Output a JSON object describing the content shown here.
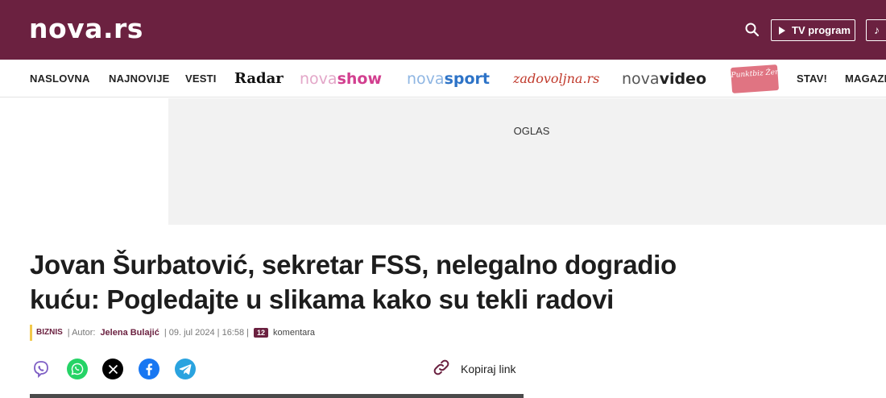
{
  "header": {
    "logo": "nova.rs",
    "tv_program_label": "TV program",
    "search_icon": "search-icon",
    "music_icon": "music-note-icon",
    "background_color": "#6b2140"
  },
  "nav": {
    "naslovna": "NASLOVNA",
    "najnovije": "NAJNOVIJE",
    "vesti": "VESTI",
    "radar": "Radar",
    "nova_show_a": "nova",
    "nova_show_b": "show",
    "nova_sport_a": "nova",
    "nova_sport_b": "sport",
    "zadovoljna": "zadovoljna.rs",
    "nova_video_a": "nova",
    "nova_video_b": "video",
    "badge_text": "Punktbiz Žena",
    "stav": "STAV!",
    "magazin": "MAGAZIN"
  },
  "ad": {
    "label": "OGLAS"
  },
  "article": {
    "headline": "Jovan Šurbatović, sekretar FSS, nelegalno dogradio kuću: Pogledajte u slikama kako su tekli radovi",
    "category": "BIZNIS",
    "author_prefix": "| Autor:",
    "author": "Jelena Bulajić",
    "date": "| 09. jul 2024 | 16:58 |",
    "comments_count": "12",
    "comments_label": "komentara"
  },
  "share": {
    "viber_icon": "viber-icon",
    "whatsapp_icon": "whatsapp-icon",
    "x_icon": "x-icon",
    "facebook_icon": "facebook-icon",
    "telegram_icon": "telegram-icon",
    "copy_link_label": "Kopiraj link",
    "colors": {
      "viber": "#7d5dc4",
      "whatsapp": "#25d366",
      "x": "#000000",
      "facebook": "#1877f2",
      "telegram": "#2aa3df"
    }
  }
}
